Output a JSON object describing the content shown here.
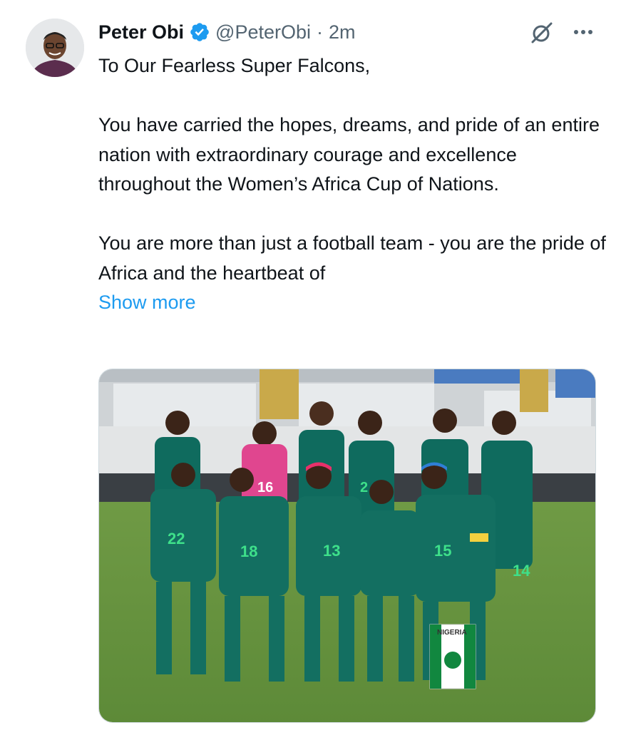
{
  "tweet": {
    "author_name": "Peter Obi",
    "handle": "@PeterObi",
    "separator": "·",
    "timestamp": "2m",
    "paragraph_1": "To Our Fearless Super Falcons,",
    "paragraph_2": "You have carried the hopes, dreams, and pride of an entire nation with extraordinary courage and excellence throughout the Women’s Africa Cup of Nations.",
    "paragraph_3": "You are more than just a football team - you are the pride of Africa and the heartbeat of",
    "show_more_label": "Show more"
  },
  "media": {
    "pennant_text": "NIGERIA",
    "jersey_numbers": [
      "16",
      "2",
      "22",
      "18",
      "13",
      "15",
      "14"
    ]
  },
  "icons": {
    "verified": "verified-badge-icon",
    "grok": "grok-icon",
    "more": "more-options-icon"
  },
  "colors": {
    "accent": "#1d9bf0",
    "secondary_text": "#536471",
    "jersey_green": "#0f6b5e",
    "keeper_pink": "#e0468f"
  }
}
